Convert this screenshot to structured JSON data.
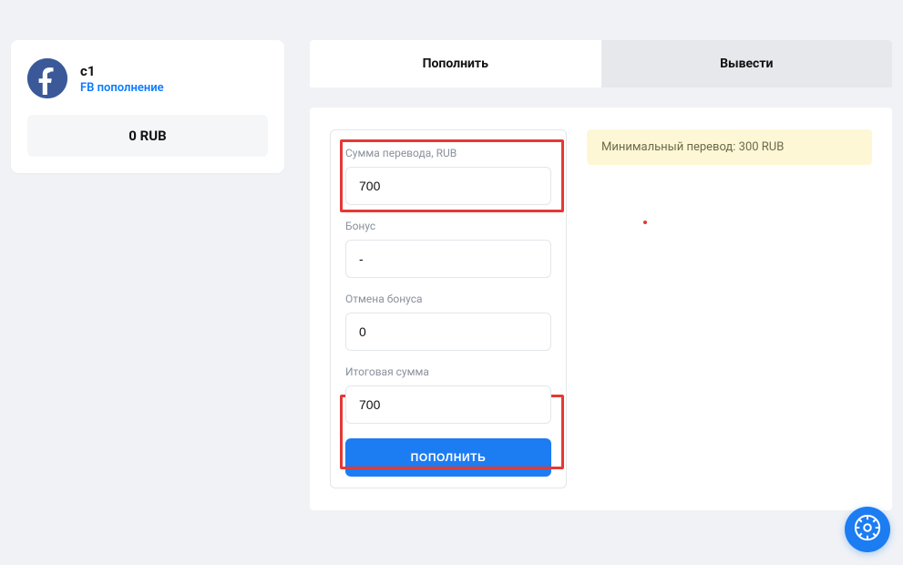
{
  "sidebar": {
    "account_name": "c1",
    "account_subtitle": "FB пополнение",
    "balance": "0 RUB"
  },
  "tabs": {
    "deposit": "Пополнить",
    "withdraw": "Вывести"
  },
  "form": {
    "amount_label": "Сумма перевода, RUB",
    "amount_value": "700",
    "bonus_label": "Бонус",
    "bonus_value": "-",
    "bonus_cancel_label": "Отмена бонуса",
    "bonus_cancel_value": "0",
    "total_label": "Итоговая сумма",
    "total_value": "700",
    "submit_label": "ПОПОЛНИТЬ"
  },
  "notice": {
    "min_transfer": "Минимальный перевод: 300 RUB"
  }
}
